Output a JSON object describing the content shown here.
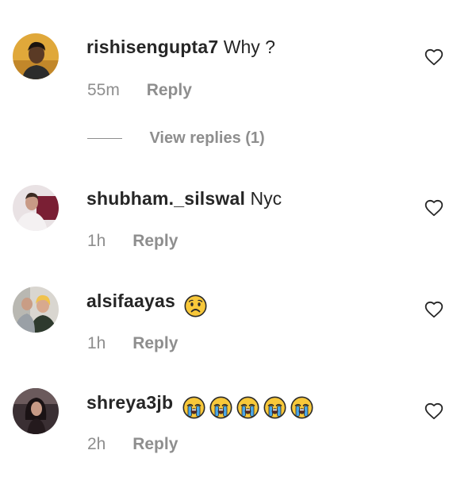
{
  "comments": [
    {
      "username": "rishisengupta7",
      "text": "Why ?",
      "time": "55m",
      "reply_label": "Reply",
      "avatar_icon": "avatar-icon",
      "like_icon": "heart-icon"
    },
    {
      "username": "shubham._silswal",
      "text": "Nyc",
      "time": "1h",
      "reply_label": "Reply",
      "avatar_icon": "avatar-icon",
      "like_icon": "heart-icon"
    },
    {
      "username": "alsifaayas",
      "text": "",
      "emojis": [
        "sad-face-emoji"
      ],
      "time": "1h",
      "reply_label": "Reply",
      "avatar_icon": "avatar-icon",
      "like_icon": "heart-icon"
    },
    {
      "username": "shreya3jb",
      "text": "",
      "emojis": [
        "crying-face-emoji",
        "crying-face-emoji",
        "crying-face-emoji",
        "crying-face-emoji",
        "crying-face-emoji"
      ],
      "time": "2h",
      "reply_label": "Reply",
      "avatar_icon": "avatar-icon",
      "like_icon": "heart-icon"
    }
  ],
  "view_replies": {
    "label": "View replies (1)"
  },
  "colors": {
    "text": "#262626",
    "secondary": "#8e8e8e",
    "background": "#ffffff"
  }
}
